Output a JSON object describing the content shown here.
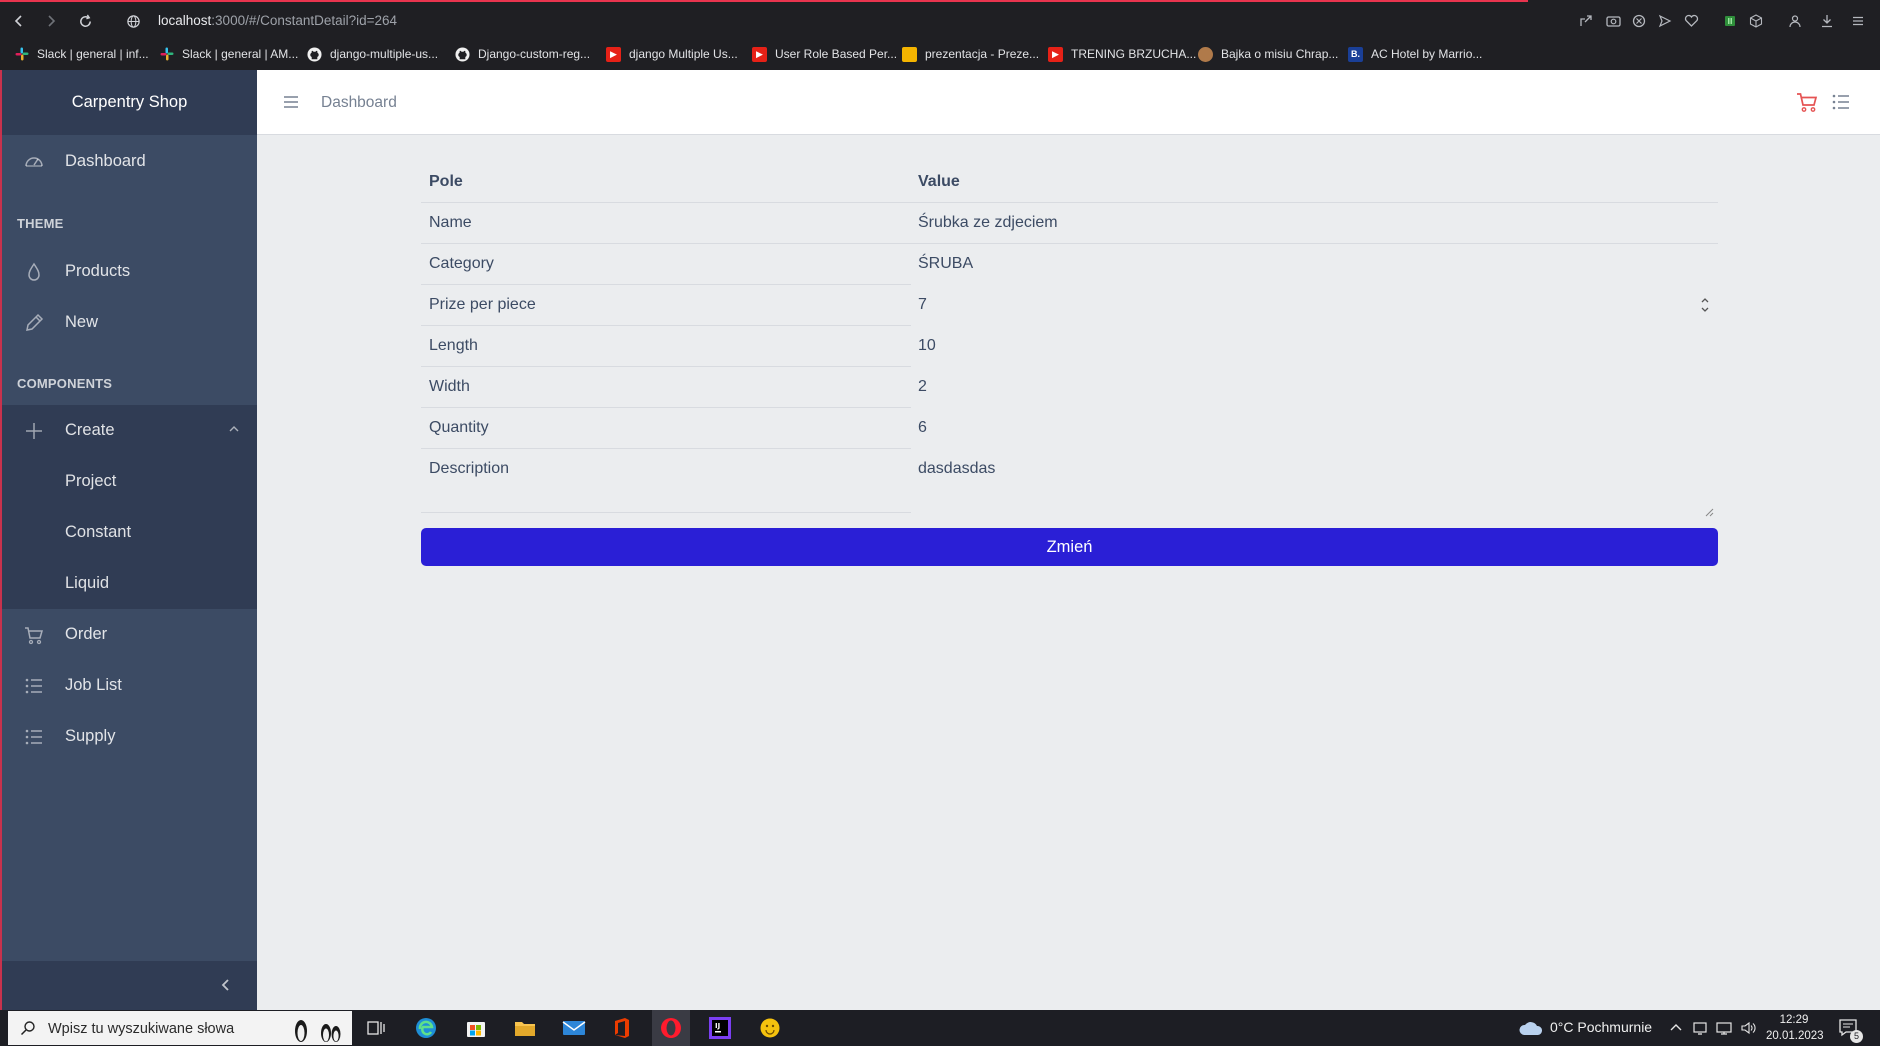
{
  "browser": {
    "url_host": "localhost",
    "url_rest": ":3000/#/ConstantDetail?id=264",
    "bookmarks": [
      {
        "label": "Slack | general | inf...",
        "icon": "slack-icon"
      },
      {
        "label": "Slack | general | AM...",
        "icon": "slack-icon"
      },
      {
        "label": "django-multiple-us...",
        "icon": "github-icon"
      },
      {
        "label": "Django-custom-reg...",
        "icon": "github-icon"
      },
      {
        "label": "django Multiple Us...",
        "icon": "youtube-icon"
      },
      {
        "label": "User Role Based Per...",
        "icon": "youtube-icon"
      },
      {
        "label": "prezentacja - Preze...",
        "icon": "slides-icon"
      },
      {
        "label": "TRENING BRZUCHA...",
        "icon": "youtube-icon"
      },
      {
        "label": "Bajka o misiu Chrap...",
        "icon": "bear-icon"
      },
      {
        "label": "AC Hotel by Marrio...",
        "icon": "booking-icon"
      }
    ]
  },
  "sidebar": {
    "brand": "Carpentry Shop",
    "dashboard": "Dashboard",
    "section_theme": "THEME",
    "products": "Products",
    "new": "New",
    "section_components": "COMPONENTS",
    "create": "Create",
    "project": "Project",
    "constant": "Constant",
    "liquid": "Liquid",
    "order": "Order",
    "job_list": "Job List",
    "supply": "Supply"
  },
  "header": {
    "title": "Dashboard"
  },
  "table": {
    "head_field": "Pole",
    "head_value": "Value",
    "rows": [
      {
        "label": "Name",
        "value": "Śrubka ze zdjeciem"
      },
      {
        "label": "Category",
        "value": "ŚRUBA"
      },
      {
        "label": "Prize per piece",
        "value": "7"
      },
      {
        "label": "Length",
        "value": "10"
      },
      {
        "label": "Width",
        "value": "2"
      },
      {
        "label": "Quantity",
        "value": "6"
      },
      {
        "label": "Description",
        "value": "dasdasdas"
      }
    ]
  },
  "submit_label": "Zmień",
  "taskbar": {
    "search_placeholder": "Wpisz tu wyszukiwane słowa",
    "weather": "0°C  Pochmurnie",
    "time": "12:29",
    "date": "20.01.2023",
    "notifications": "5"
  },
  "colors": {
    "sidebar": "#3c4b64",
    "sidebar_dark": "#303c54",
    "primary_button": "#2a1fd6",
    "cart_icon": "#e55353"
  }
}
